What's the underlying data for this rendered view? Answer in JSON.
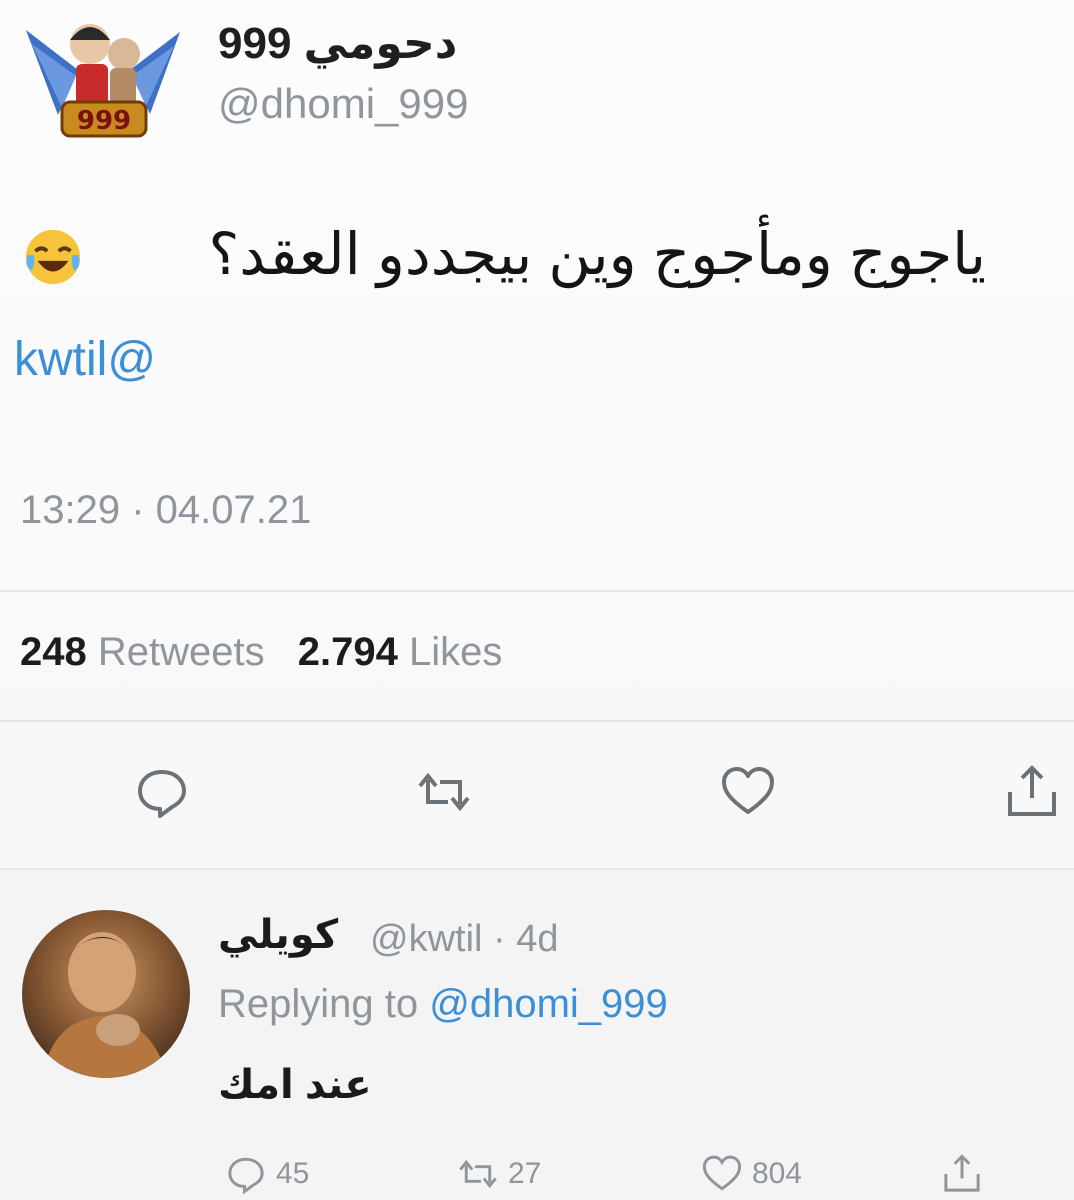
{
  "tweet": {
    "display_name": "دحومي 999",
    "handle": "@dhomi_999",
    "text": "ياجوج ومأجوج وين بيجددو العقد؟",
    "emoji": "face-with-tears-of-joy",
    "mention": "kwtil@",
    "timestamp": "13:29 · 04.07.21",
    "retweets_count": "248",
    "retweets_label": "Retweets",
    "likes_count": "2.794",
    "likes_label": "Likes"
  },
  "actions": {
    "reply_icon": "reply-icon",
    "retweet_icon": "retweet-icon",
    "like_icon": "heart-icon",
    "share_icon": "share-icon"
  },
  "reply": {
    "display_name": "كويلي",
    "handle_time": "@kwtil · 4d",
    "replying_prefix": "Replying to",
    "replying_handle": "@dhomi_999",
    "text": "عند امك",
    "reply_count": "45",
    "retweet_count": "27",
    "like_count": "804"
  },
  "colors": {
    "link": "#3b8fd6",
    "muted": "#8e959c",
    "text": "#141414"
  }
}
